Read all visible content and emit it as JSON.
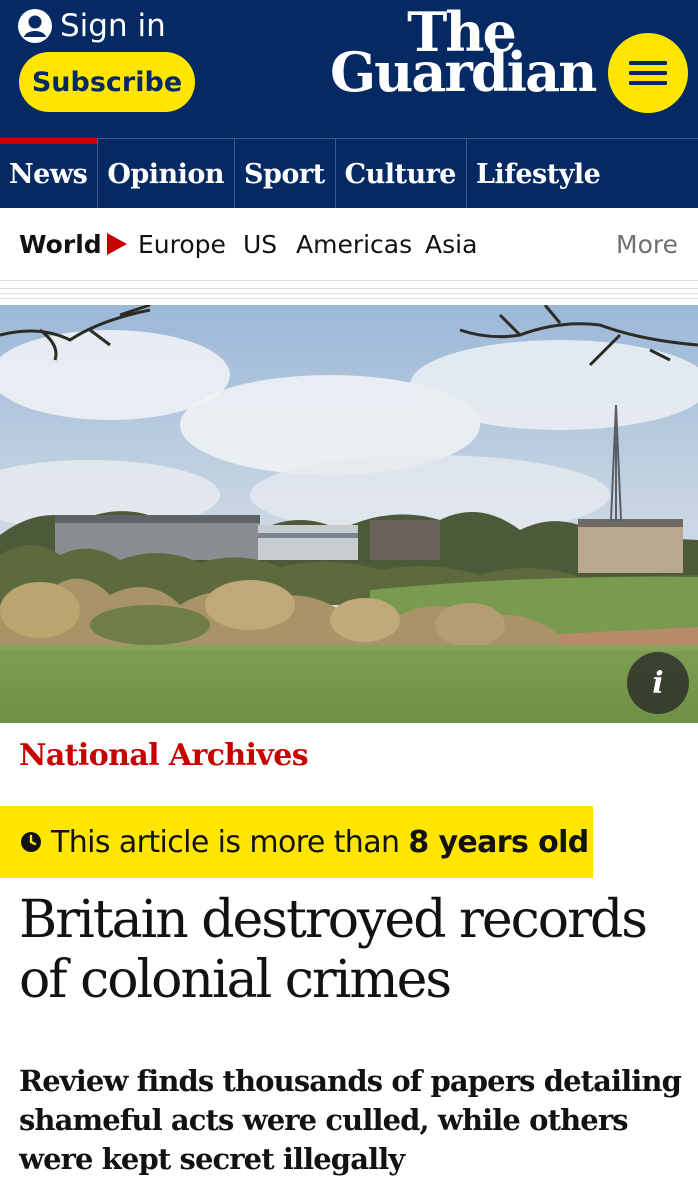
{
  "header": {
    "sign_in_label": "Sign in",
    "subscribe_label": "Subscribe",
    "logo_line1": "The",
    "logo_line2": "Guardian",
    "menu_icon": "hamburger-menu-icon",
    "brand_color": "#052962",
    "accent_color": "#ffe500"
  },
  "pillars": [
    {
      "label": "News",
      "active": true
    },
    {
      "label": "Opinion"
    },
    {
      "label": "Sport"
    },
    {
      "label": "Culture"
    },
    {
      "label": "Lifestyle"
    }
  ],
  "subnav": {
    "section": "World",
    "items": [
      "Europe",
      "US",
      "Americas",
      "Asia"
    ],
    "more_label": "More"
  },
  "hero": {
    "info_label": "i"
  },
  "article": {
    "kicker": "National Archives",
    "age_prefix": "This article is more than ",
    "age_value": "8 years old",
    "headline": "Britain destroyed records of colonial crimes",
    "standfirst": "Review finds thousands of papers detailing shameful acts were culled, while others were kept secret illegally",
    "kicker_color": "#c70000"
  }
}
